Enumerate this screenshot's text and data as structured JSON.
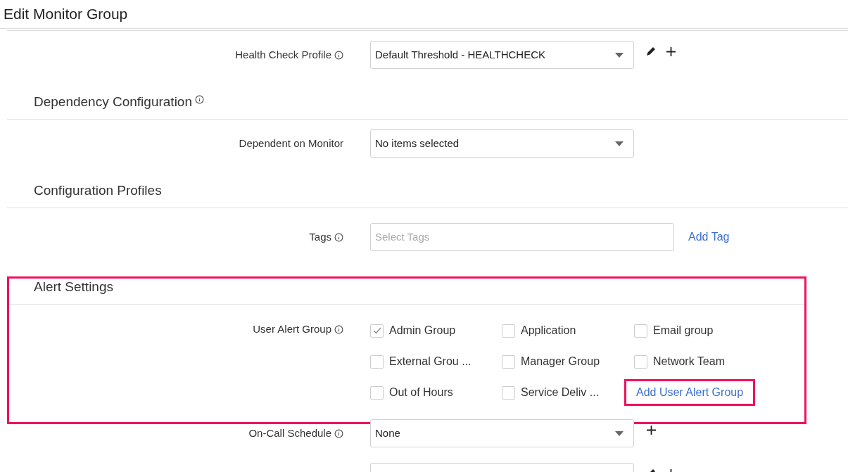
{
  "title": "Edit Monitor Group",
  "sections": [
    {
      "highlighted": false,
      "rows": [
        {
          "kind": "select",
          "label": "Health Check Profile",
          "info": true,
          "value": "Default Threshold - HEALTHCHECK",
          "actions": [
            {
              "kind": "edit"
            },
            {
              "kind": "add"
            }
          ]
        }
      ]
    },
    {
      "heading": "Dependency Configuration",
      "heading_info": true,
      "highlighted": false,
      "rows": [
        {
          "kind": "select",
          "label": "Dependent on Monitor",
          "info": false,
          "value": "No items selected",
          "actions": []
        }
      ]
    },
    {
      "heading": "Configuration Profiles",
      "heading_info": false,
      "highlighted": false,
      "rows": [
        {
          "kind": "tags",
          "label": "Tags",
          "info": true,
          "placeholder": "Select Tags",
          "link": "Add Tag"
        }
      ]
    },
    {
      "heading": "Alert Settings",
      "heading_info": false,
      "highlighted": true,
      "rows": [
        {
          "kind": "checkboxes",
          "label": "User Alert Group",
          "info": true,
          "options": [
            {
              "label": "Admin Group",
              "checked": true
            },
            {
              "label": "Application",
              "checked": false
            },
            {
              "label": "Email group",
              "checked": false
            },
            {
              "label": "External Grou ...",
              "checked": false
            },
            {
              "label": "Manager Group",
              "checked": false
            },
            {
              "label": "Network Team",
              "checked": false
            },
            {
              "label": "Out of Hours",
              "checked": false
            },
            {
              "label": "Service Deliv ...",
              "checked": false
            }
          ],
          "link": {
            "label": "Add User Alert Group",
            "highlighted": true
          }
        }
      ]
    },
    {
      "highlighted": false,
      "rows": [
        {
          "kind": "select",
          "label": "On-Call Schedule",
          "info": true,
          "value": "None",
          "actions": [
            {
              "kind": "add"
            }
          ]
        },
        {
          "kind": "select_cut",
          "actions": [
            {
              "kind": "edit"
            },
            {
              "kind": "add"
            }
          ]
        }
      ]
    }
  ]
}
